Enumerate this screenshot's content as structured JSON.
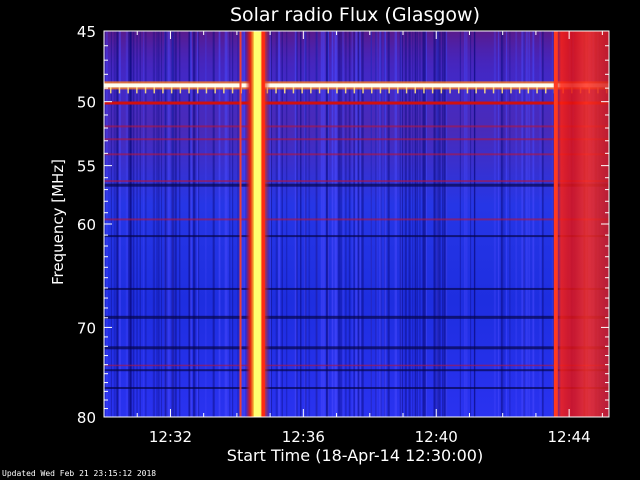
{
  "chart_data": {
    "type": "heatmap",
    "title": "Solar radio Flux (Glasgow)",
    "xlabel": "Start Time (18-Apr-14 12:30:00)",
    "ylabel": "Frequency [MHz]",
    "xlim": [
      0.0,
      15.2
    ],
    "ylim": [
      45,
      80
    ],
    "x_unit": "minutes after 12:30:00",
    "y_scale": "log",
    "y_inverted": true,
    "xticks": [
      {
        "value": 2,
        "label": "12:32"
      },
      {
        "value": 6,
        "label": "12:36"
      },
      {
        "value": 10,
        "label": "12:40"
      },
      {
        "value": 14,
        "label": "12:44"
      }
    ],
    "yticks": [
      45,
      50,
      55,
      60,
      70,
      80
    ],
    "colormap": [
      "#000000",
      "#1a1aff",
      "#ff2020",
      "#ffff40",
      "#ffffff"
    ],
    "features": [
      {
        "kind": "burst",
        "x_start": 4.25,
        "x_end": 5.0,
        "peak_x": 4.6,
        "intensity": "high"
      },
      {
        "kind": "burst",
        "x_start": 13.5,
        "x_end": 15.2,
        "peak_x": 13.6,
        "intensity": "medium"
      },
      {
        "kind": "interference_line",
        "freq": 48.8,
        "intensity": "high"
      },
      {
        "kind": "interference_line",
        "freq": 50.1,
        "intensity": "medium"
      }
    ]
  },
  "footer": "Updated Wed Feb 21 23:15:12 2018"
}
